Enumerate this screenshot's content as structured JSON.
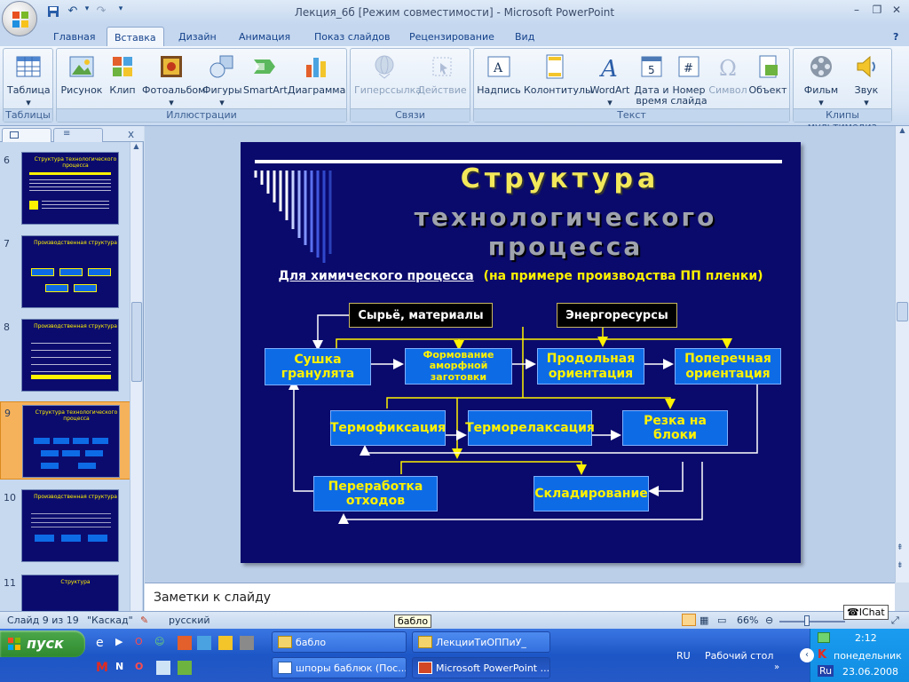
{
  "window": {
    "title": "Лекция_6б [Режим совместимости] - Microsoft PowerPoint",
    "controls": [
      "–",
      "❐",
      "✕"
    ]
  },
  "ribbon_tabs": [
    "Главная",
    "Вставка",
    "Дизайн",
    "Анимация",
    "Показ слайдов",
    "Рецензирование",
    "Вид"
  ],
  "ribbon": {
    "groups": [
      {
        "label": "Таблицы",
        "buttons": [
          "Таблица"
        ]
      },
      {
        "label": "Иллюстрации",
        "buttons": [
          "Рисунок",
          "Клип",
          "Фотоальбом",
          "Фигуры",
          "SmartArt",
          "Диаграмма"
        ]
      },
      {
        "label": "Связи",
        "buttons": [
          "Гиперссылка",
          "Действие"
        ]
      },
      {
        "label": "Текст",
        "buttons": [
          "Надпись",
          "Колонтитулы",
          "WordArt",
          "Дата и время",
          "Номер слайда",
          "Символ",
          "Объект"
        ]
      },
      {
        "label": "Клипы мультимедиа",
        "buttons": [
          "Фильм",
          "Звук"
        ]
      }
    ]
  },
  "thumbnails": [
    {
      "num": "6",
      "title": "Структура технологического процесса"
    },
    {
      "num": "7",
      "title": "Производственная структура"
    },
    {
      "num": "8",
      "title": "Производственная структура"
    },
    {
      "num": "9",
      "title": "Структура технологического процесса"
    },
    {
      "num": "10",
      "title": "Производственная структура"
    },
    {
      "num": "11",
      "title": "Структура"
    }
  ],
  "slide": {
    "title_line1": "Структура",
    "title_line2": "технологического процесса",
    "subtitle_underlined": "Для химического процесса",
    "subtitle_rest": "(на примере производства ПП пленки)",
    "inputs": [
      "Сырьё, материалы",
      "Энергоресурсы"
    ],
    "boxes": {
      "drying": "Сушка гранулята",
      "forming": "Формование аморфной заготовки",
      "longitudinal": "Продольная ориентация",
      "transverse": "Поперечная ориентация",
      "thermofix": "Термофиксация",
      "thermorelax": "Терморелаксация",
      "cutting": "Резка на блоки",
      "recycling": "Переработка отходов",
      "storage": "Складирование"
    }
  },
  "notes_placeholder": "Заметки к слайду",
  "statusbar": {
    "slide_info": "Слайд 9 из 19",
    "theme": "\"Каскад\"",
    "language": "русский",
    "zoom": "66%",
    "tooltip": "бабло",
    "ichat": "IChat"
  },
  "taskbar": {
    "start": "пуск",
    "tasks": [
      "бабло",
      "ЛекцииТиОППиУ_",
      "шпоры баблюк (Пос...",
      "Microsoft PowerPoint ..."
    ],
    "tray": {
      "lang": "RU",
      "desktop": "Рабочий стол",
      "time": "2:12",
      "day": "понедельник",
      "date": "23.06.2008",
      "lang_badge": "Ru"
    }
  }
}
